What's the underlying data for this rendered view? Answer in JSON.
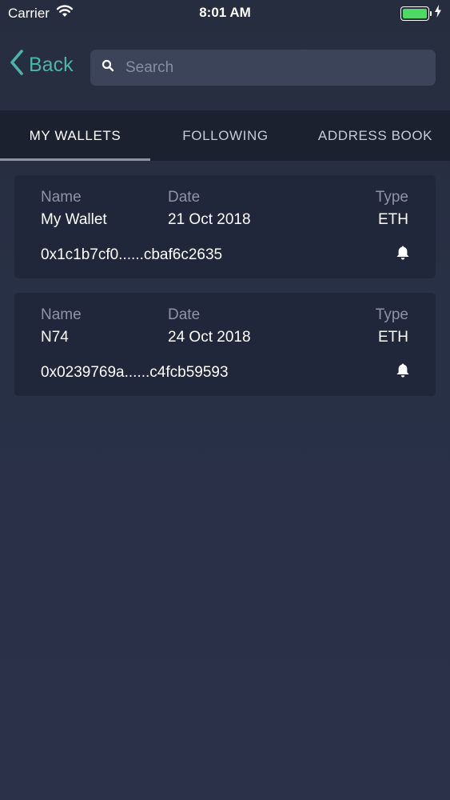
{
  "status_bar": {
    "carrier": "Carrier",
    "time": "8:01 AM",
    "battery_level": 1.0
  },
  "nav": {
    "back_label": "Back",
    "search_placeholder": "Search"
  },
  "tabs": [
    {
      "label": "MY WALLETS",
      "active": true
    },
    {
      "label": "FOLLOWING",
      "active": false
    },
    {
      "label": "ADDRESS BOOK",
      "active": false
    }
  ],
  "headers": {
    "name": "Name",
    "date": "Date",
    "type": "Type"
  },
  "wallets": [
    {
      "name": "My Wallet",
      "date": "21 Oct 2018",
      "type": "ETH",
      "address": "0x1c1b7cf0......cbaf6c2635",
      "icon": "bell-icon"
    },
    {
      "name": "N74",
      "date": "24 Oct 2018",
      "type": "ETH",
      "address": "0x0239769a......c4fcb59593",
      "icon": "bell-icon"
    }
  ],
  "colors": {
    "accent": "#4fb3a9",
    "background": "#283046",
    "card": "#20273a",
    "tab_bar": "#1c2130",
    "battery": "#4cd964"
  }
}
